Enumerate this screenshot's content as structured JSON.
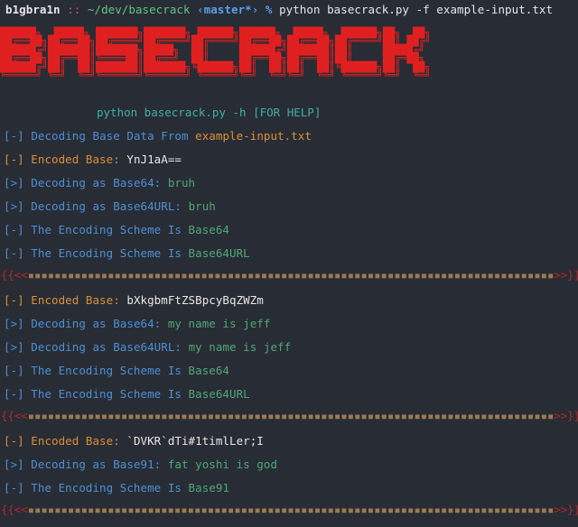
{
  "terminal": {
    "background_color": "#282c34",
    "prompt": {
      "user": "b1gbra1n",
      "separator": "::",
      "path": "~/dev/basecrack",
      "git_branch": "‹master*›",
      "sigil": "%",
      "command": "python basecrack.py -f example-input.txt"
    },
    "banner": {
      "text": "BASECRACK",
      "color": "#e02020",
      "art": [
        "██████╗  █████╗ ███████╗███████╗ ██████╗██████╗  █████╗  ██████╗██╗  ██╗",
        "██╔══██╗██╔══██╗██╔════╝██╔════╝██╔════╝██╔══██╗██╔══██╗██╔════╝██║ ██╔╝",
        "██████╔╝███████║███████╗█████╗  ██║     ██████╔╝███████║██║     █████╔╝ ",
        "██╔══██╗██╔══██║╚════██║██╔══╝  ██║     ██╔══██╗██╔══██║██║     ██╔═██╗ ",
        "██████╔╝██║  ██║███████║███████╗╚██████╗██║  ██║██║  ██║╚██████╗██║  ██╗",
        "╚═════╝ ╚═╝  ╚═╝╚══════╝╚══════╝ ╚═════╝╚═╝  ╚═╝╚═╝  ╚═╝ ╚═════╝╚═╝  ╚═╝"
      ]
    },
    "help_hint": "python basecrack.py -h [FOR HELP]",
    "decoding_header": {
      "tag": "[-] ",
      "label": "Decoding Base Data From ",
      "filename": "example-input.txt"
    },
    "separator": {
      "left": "{{<<",
      "fill": "▪▪▪▪▪▪▪▪▪▪▪▪▪▪▪▪▪▪▪▪▪▪▪▪▪▪▪▪▪▪▪▪▪▪▪▪▪▪▪▪▪▪▪▪▪▪▪▪▪▪▪▪▪▪▪▪▪▪▪▪▪▪▪▪▪▪▪▪▪▪▪▪▪▪▪▪▪▪▪",
      "right": ">>}}"
    },
    "labels": {
      "encoded_base": "[-] Encoded Base: ",
      "decoding_as": "[>] Decoding as ",
      "scheme_is": "[-] The Encoding Scheme Is "
    },
    "blocks": [
      {
        "encoded": "YnJ1aA==",
        "decodes": [
          {
            "scheme": "Base64",
            "result": "bruh"
          },
          {
            "scheme": "Base64URL",
            "result": "bruh"
          }
        ],
        "schemes": [
          "Base64",
          "Base64URL"
        ]
      },
      {
        "encoded": "bXkgbmFtZSBpcyBqZWZm",
        "decodes": [
          {
            "scheme": "Base64",
            "result": "my name is jeff"
          },
          {
            "scheme": "Base64URL",
            "result": "my name is jeff"
          }
        ],
        "schemes": [
          "Base64",
          "Base64URL"
        ]
      },
      {
        "encoded": "`DVKR`dTi#1timlLer;I",
        "decodes": [
          {
            "scheme": "Base91",
            "result": "fat yoshi is god"
          }
        ],
        "schemes": [
          "Base91"
        ]
      }
    ],
    "colors": {
      "blue": "#4e8fd4",
      "orange": "#d8903a",
      "white": "#e8e8e8",
      "green": "#4fa877",
      "red": "#b02a2a",
      "dash": "#9a7a55",
      "teal": "#3fb0a8"
    }
  }
}
